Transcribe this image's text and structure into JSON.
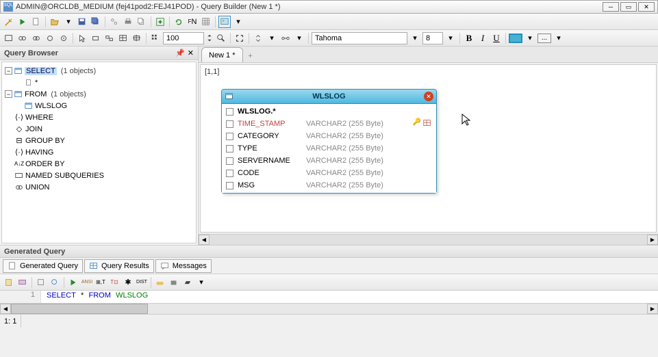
{
  "titlebar": {
    "text": "ADMIN@ORCLDB_MEDIUM (fej41pod2:FEJ41POD) - Query Builder (New 1 *)"
  },
  "toolbar2": {
    "num_value": "100",
    "font_value": "Tahoma",
    "size_value": "8"
  },
  "sidebar": {
    "title": "Query Browser",
    "tree": {
      "select": {
        "label": "SELECT",
        "count": "(1 objects)"
      },
      "star": "*",
      "from": {
        "label": "FROM",
        "count": "(1 objects)"
      },
      "wlslog": "WLSLOG",
      "where": "WHERE",
      "join": "JOIN",
      "groupby": "GROUP BY",
      "having": "HAVING",
      "orderby": "ORDER BY",
      "named_subqueries": "NAMED SUBQUERIES",
      "union": "UNION"
    }
  },
  "tabs": {
    "active": "New 1 *"
  },
  "canvas": {
    "coord": "[1,1]"
  },
  "table": {
    "title": "WLSLOG",
    "rows": [
      {
        "name": "WLSLOG.*",
        "type": "",
        "bold": true
      },
      {
        "name": "TIME_STAMP",
        "type": "VARCHAR2 (255 Byte)",
        "red": true,
        "icons": true
      },
      {
        "name": "CATEGORY",
        "type": "VARCHAR2 (255 Byte)"
      },
      {
        "name": "TYPE",
        "type": "VARCHAR2 (255 Byte)"
      },
      {
        "name": "SERVERNAME",
        "type": "VARCHAR2 (255 Byte)"
      },
      {
        "name": "CODE",
        "type": "VARCHAR2 (255 Byte)"
      },
      {
        "name": "MSG",
        "type": "VARCHAR2 (255 Byte)"
      }
    ]
  },
  "gen": {
    "header": "Generated Query",
    "tabs": [
      "Generated Query",
      "Query Results",
      "Messages"
    ],
    "sql_line": "1",
    "sql_select": "SELECT",
    "sql_star": "*",
    "sql_from": "FROM",
    "sql_table": "WLSLOG"
  },
  "status": {
    "pos": "1: 1"
  }
}
